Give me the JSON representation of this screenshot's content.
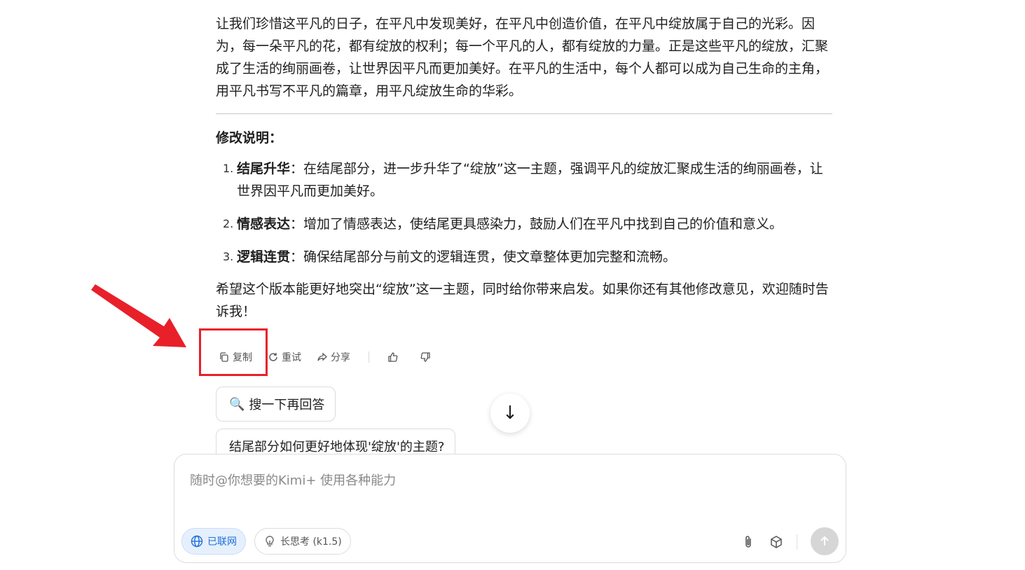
{
  "content": {
    "paragraph": "让我们珍惜这平凡的日子，在平凡中发现美好，在平凡中创造价值，在平凡中绽放属于自己的光彩。因为，每一朵平凡的花，都有绽放的权利；每一个平凡的人，都有绽放的力量。正是这些平凡的绽放，汇聚成了生活的绚丽画卷，让世界因平凡而更加美好。在平凡的生活中，每个人都可以成为自己生命的主角，用平凡书写不平凡的篇章，用平凡绽放生命的华彩。",
    "section_title": "修改说明：",
    "items": [
      {
        "num": "1.",
        "title": "结尾升华",
        "text": "：在结尾部分，进一步升华了“绽放”这一主题，强调平凡的绽放汇聚成生活的绚丽画卷，让世界因平凡而更加美好。"
      },
      {
        "num": "2.",
        "title": "情感表达",
        "text": "：增加了情感表达，使结尾更具感染力，鼓励人们在平凡中找到自己的价值和意义。"
      },
      {
        "num": "3.",
        "title": "逻辑连贯",
        "text": "：确保结尾部分与前文的逻辑连贯，使文章整体更加完整和流畅。"
      }
    ],
    "closing": "希望这个版本能更好地突出“绽放”这一主题，同时给你带来启发。如果你还有其他修改意见，欢迎随时告诉我！"
  },
  "actions": {
    "copy_label": "复制",
    "retry_label": "重试",
    "share_label": "分享"
  },
  "suggestions": {
    "search_icon": "🔍",
    "search_label": "搜一下再回答",
    "question_label": "结尾部分如何更好地体现'绽放'的主题?"
  },
  "scroll": {
    "arrow": "↓"
  },
  "input": {
    "placeholder": "随时@你想要的Kimi+ 使用各种能力",
    "web_chip": "已联网",
    "think_chip": "长思考 (k1.5)"
  },
  "colors": {
    "highlight": "#e8202a",
    "accent": "#1f6fd6"
  }
}
